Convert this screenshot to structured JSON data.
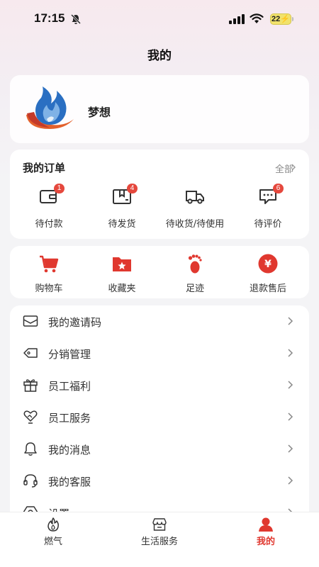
{
  "status_bar": {
    "time": "17:15",
    "battery": "22"
  },
  "page": {
    "title": "我的"
  },
  "profile": {
    "name": "梦想"
  },
  "orders": {
    "title": "我的订单",
    "all_label": "全部",
    "items": [
      {
        "label": "待付款",
        "badge": "1",
        "icon": "wallet-icon"
      },
      {
        "label": "待发货",
        "badge": "4",
        "icon": "package-icon"
      },
      {
        "label": "待收货/待使用",
        "badge": "",
        "icon": "truck-icon"
      },
      {
        "label": "待评价",
        "badge": "6",
        "icon": "comment-icon"
      }
    ]
  },
  "shortcuts": [
    {
      "label": "购物车",
      "icon": "cart-icon"
    },
    {
      "label": "收藏夹",
      "icon": "favorites-folder-icon"
    },
    {
      "label": "足迹",
      "icon": "footprint-icon"
    },
    {
      "label": "退款售后",
      "icon": "refund-icon"
    }
  ],
  "menu": [
    {
      "label": "我的邀请码",
      "icon": "envelope-icon"
    },
    {
      "label": "分销管理",
      "icon": "tag-icon"
    },
    {
      "label": "员工福利",
      "icon": "gift-icon"
    },
    {
      "label": "员工服务",
      "icon": "heart-hand-icon"
    },
    {
      "label": "我的消息",
      "icon": "bell-icon"
    },
    {
      "label": "我的客服",
      "icon": "headset-icon"
    },
    {
      "label": "设置",
      "icon": "gear-icon"
    }
  ],
  "tabs": [
    {
      "label": "燃气",
      "icon": "flame-icon",
      "active": false
    },
    {
      "label": "生活服务",
      "icon": "store-icon",
      "active": false
    },
    {
      "label": "我的",
      "icon": "user-icon",
      "active": true
    }
  ],
  "colors": {
    "accent": "#e0382f",
    "badge": "#e5483d",
    "background": "#f4f4f6"
  }
}
